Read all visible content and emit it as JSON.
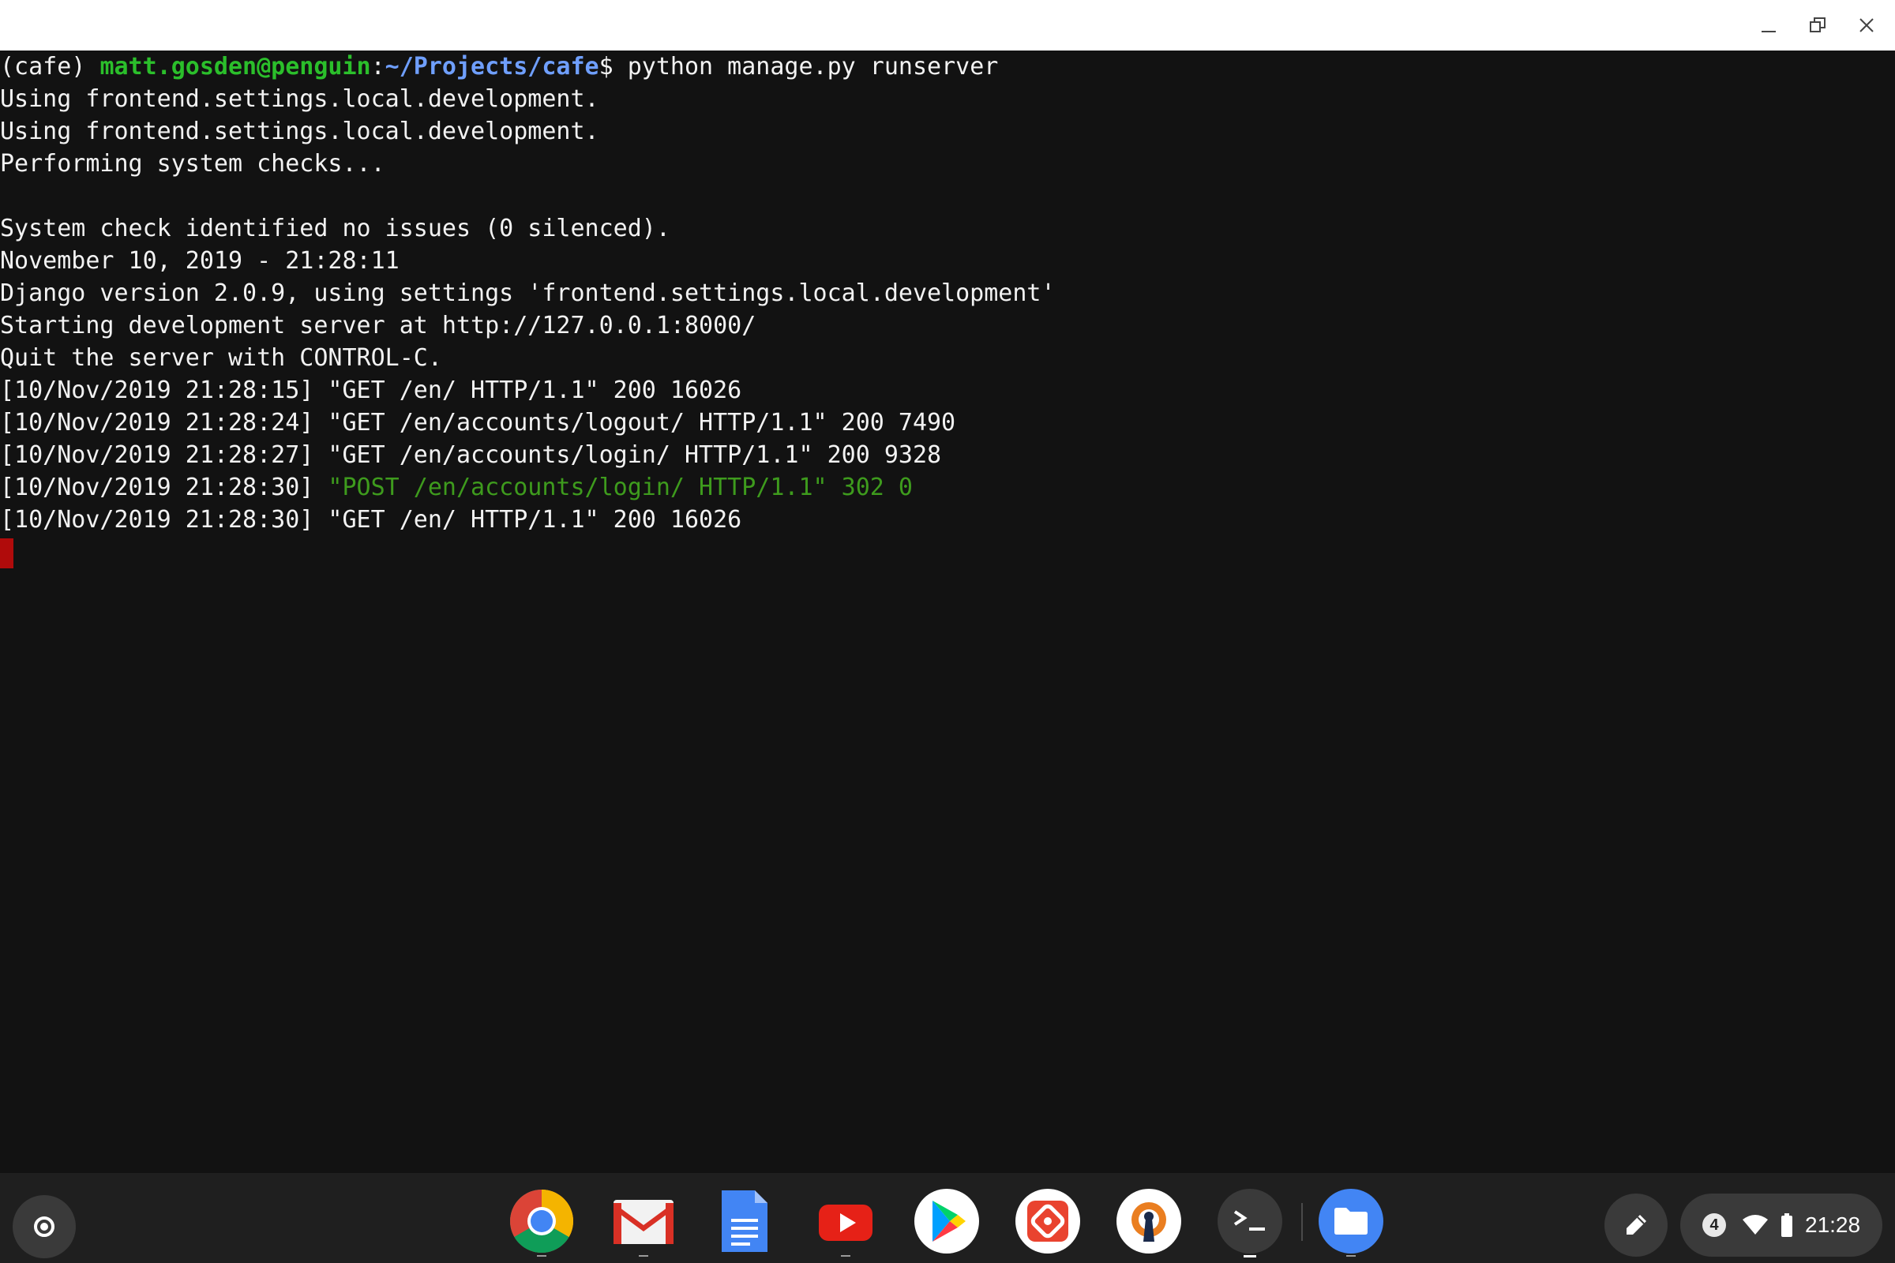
{
  "window": {
    "controls": {
      "minimize": "minimize-icon",
      "maximize": "restore-icon",
      "close": "close-icon"
    }
  },
  "terminal": {
    "prompt": {
      "venv": "(cafe) ",
      "user_host": "matt.gosden@penguin",
      "colon": ":",
      "path": "~/Projects/cafe",
      "symbol": "$",
      "command": " python manage.py runserver"
    },
    "lines": [
      "Using frontend.settings.local.development.",
      "Using frontend.settings.local.development.",
      "Performing system checks...",
      "",
      "System check identified no issues (0 silenced).",
      "November 10, 2019 - 21:28:11",
      "Django version 2.0.9, using settings 'frontend.settings.local.development'",
      "Starting development server at http://127.0.0.1:8000/",
      "Quit the server with CONTROL-C.",
      "[10/Nov/2019 21:28:15] \"GET /en/ HTTP/1.1\" 200 16026",
      "[10/Nov/2019 21:28:24] \"GET /en/accounts/logout/ HTTP/1.1\" 200 7490",
      "[10/Nov/2019 21:28:27] \"GET /en/accounts/login/ HTTP/1.1\" 200 9328"
    ],
    "post_line": {
      "prefix": "[10/Nov/2019 21:28:30] ",
      "colored": "\"POST /en/accounts/login/ HTTP/1.1\" 302 0"
    },
    "last_line": "[10/Nov/2019 21:28:30] \"GET /en/ HTTP/1.1\" 200 16026"
  },
  "shelf": {
    "launcher_icon": "launcher-icon",
    "apps": [
      {
        "name": "chrome-icon"
      },
      {
        "name": "gmail-icon"
      },
      {
        "name": "docs-icon"
      },
      {
        "name": "youtube-icon"
      },
      {
        "name": "play-store-icon"
      },
      {
        "name": "remote-desktop-icon"
      },
      {
        "name": "openvpn-icon"
      },
      {
        "name": "terminal-icon"
      },
      {
        "name": "files-icon"
      }
    ],
    "tray": {
      "notification_count": "4",
      "time": "21:28"
    }
  },
  "colors": {
    "terminal_bg": "#121212",
    "prompt_user": "#2bbf2b",
    "prompt_path": "#6f9fff",
    "post_line": "#3e9b1d",
    "cursor": "#b00b0b",
    "shelf_bg": "#1f1f1f"
  }
}
